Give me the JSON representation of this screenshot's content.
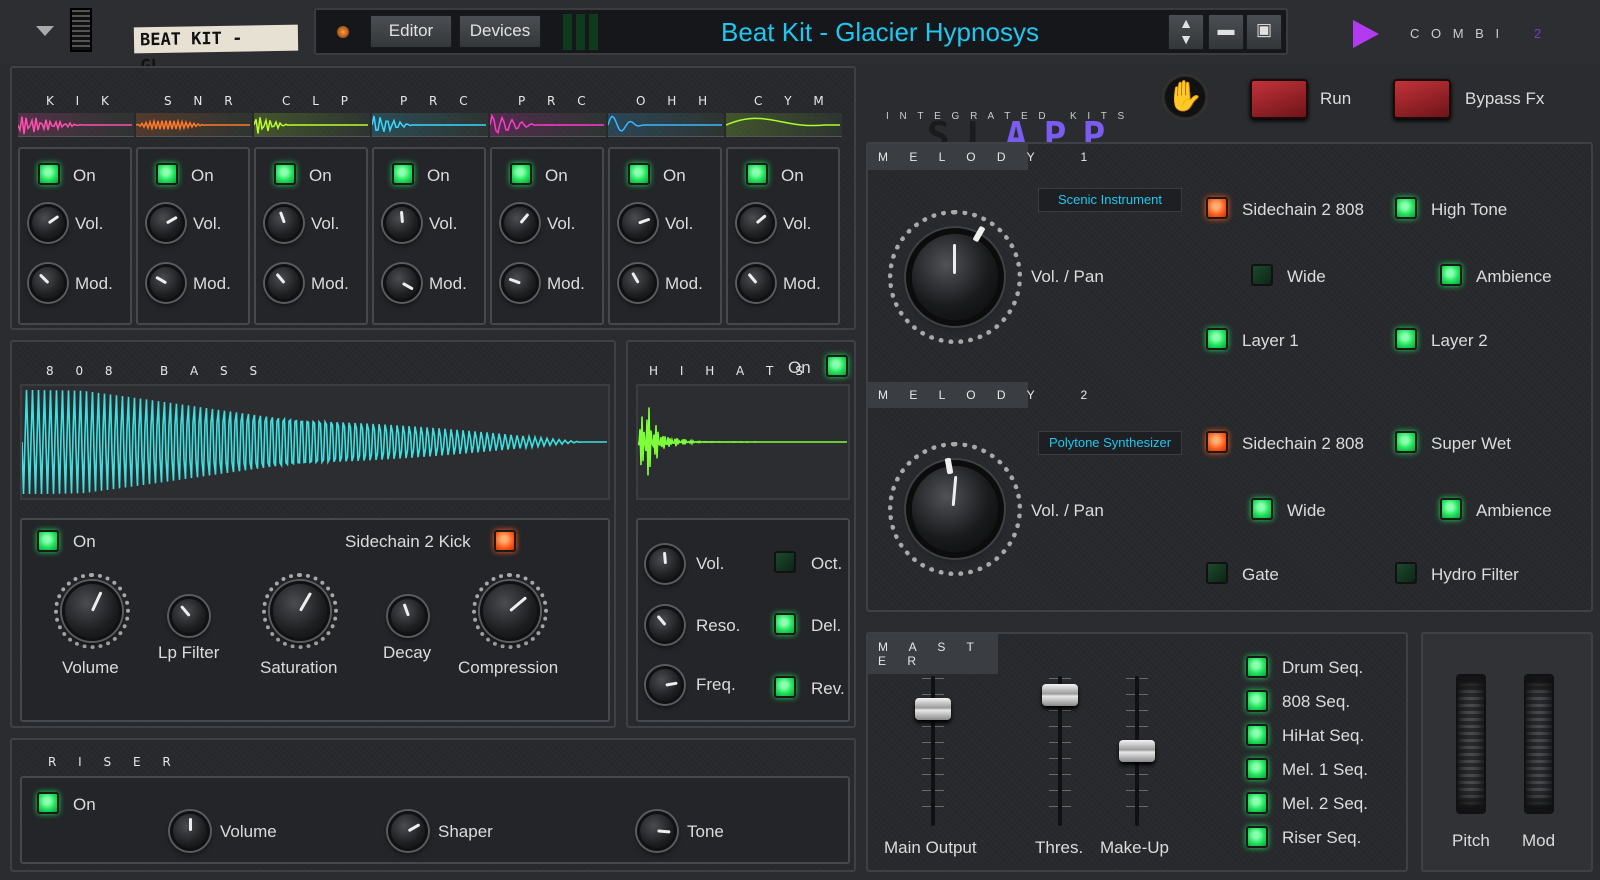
{
  "topbar": {
    "menu_icon": "dropdown-triangle-icon",
    "patch_label": "BEAT KIT - GL...",
    "editor_btn": "Editor",
    "devices_btn": "Devices",
    "patch_title": "Beat Kit - Glacier Hypnosys",
    "combi_label": "C O M B I",
    "combi_num": "2"
  },
  "drums": {
    "channels": [
      {
        "name": "K I K",
        "color": "#ff4fb0",
        "on": "On",
        "vol": "Vol.",
        "mod": "Mod."
      },
      {
        "name": "S N R",
        "color": "#ff7a2a",
        "on": "On",
        "vol": "Vol.",
        "mod": "Mod."
      },
      {
        "name": "C L P",
        "color": "#b8ff2a",
        "on": "On",
        "vol": "Vol.",
        "mod": "Mod."
      },
      {
        "name": "P R C",
        "color": "#3ad8ff",
        "on": "On",
        "vol": "Vol.",
        "mod": "Mod."
      },
      {
        "name": "P R C",
        "color": "#ff3ad0",
        "on": "On",
        "vol": "Vol.",
        "mod": "Mod."
      },
      {
        "name": "O H H",
        "color": "#3ab8ff",
        "on": "On",
        "vol": "Vol.",
        "mod": "Mod."
      },
      {
        "name": "C Y M",
        "color": "#a8ff2a",
        "on": "On",
        "vol": "Vol.",
        "mod": "Mod."
      }
    ]
  },
  "bass": {
    "title": "8 0 8   B A S S",
    "wave_color": "#3de0e0",
    "on": "On",
    "sidechain": "Sidechain 2 Kick",
    "knobs": [
      "Volume",
      "Lp Filter",
      "Saturation",
      "Decay",
      "Compression"
    ]
  },
  "hihats": {
    "title": "H I H A T S",
    "on": "On",
    "wave_color": "#7dff3a",
    "vol": "Vol.",
    "reso": "Reso.",
    "freq": "Freq.",
    "oct": "Oct.",
    "del": "Del.",
    "rev": "Rev."
  },
  "riser": {
    "title": "R I S E R",
    "on": "On",
    "volume": "Volume",
    "shaper": "Shaper",
    "tone": "Tone"
  },
  "brand": {
    "letters": "S L A P P",
    "sub": "I N T E G R A T E D   K I T S",
    "run": "Run",
    "bypass": "Bypass Fx"
  },
  "melody1": {
    "title": "M E L O D Y   1",
    "instrument": "Scenic Instrument",
    "volpan": "Vol. / Pan",
    "sidechain": "Sidechain 2 808",
    "high_tone": "High Tone",
    "wide": "Wide",
    "ambience": "Ambience",
    "layer1": "Layer 1",
    "layer2": "Layer 2"
  },
  "melody2": {
    "title": "M E L O D Y   2",
    "instrument": "Polytone Synthesizer",
    "volpan": "Vol. / Pan",
    "sidechain": "Sidechain 2 808",
    "super_wet": "Super Wet",
    "wide": "Wide",
    "ambience": "Ambience",
    "gate": "Gate",
    "hydro": "Hydro Filter"
  },
  "master": {
    "title": "M A S T E R",
    "main_output": "Main Output",
    "thres": "Thres.",
    "makeup": "Make-Up",
    "seqs": [
      "Drum Seq.",
      "808 Seq.",
      "HiHat Seq.",
      "Mel. 1 Seq.",
      "Mel. 2 Seq.",
      "Riser Seq."
    ],
    "pitch": "Pitch",
    "mod": "Mod"
  }
}
